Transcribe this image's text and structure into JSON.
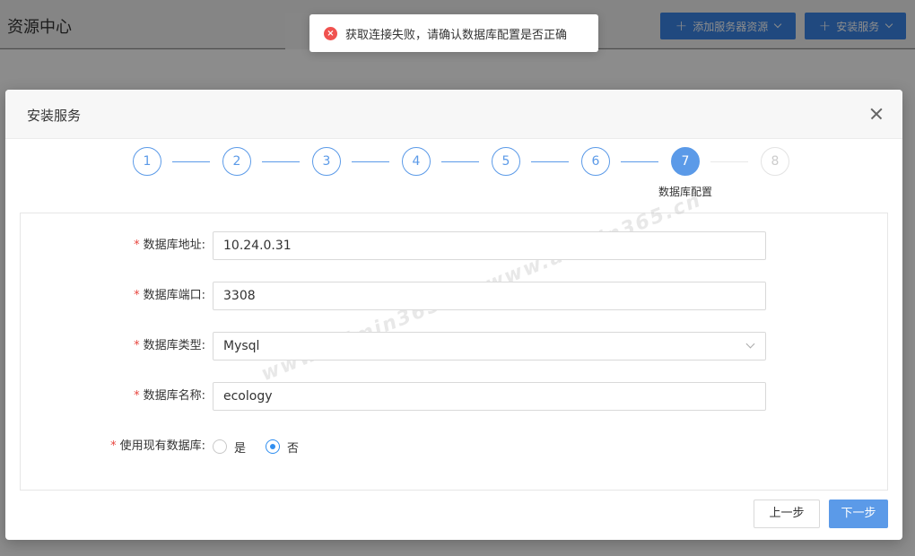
{
  "page": {
    "title": "资源中心",
    "add_server_button": "添加服务器资源",
    "install_service_button": "安装服务"
  },
  "toast": {
    "message": "获取连接失败，请确认数据库配置是否正确",
    "icon": "error-icon"
  },
  "modal": {
    "title": "安装服务",
    "steps": [
      "1",
      "2",
      "3",
      "4",
      "5",
      "6",
      "7",
      "8"
    ],
    "current_step": 7,
    "current_step_label": "数据库配置",
    "fields": {
      "db_address": {
        "label": "数据库地址:",
        "value": "10.24.0.31"
      },
      "db_port": {
        "label": "数据库端口:",
        "value": "3308"
      },
      "db_type": {
        "label": "数据库类型:",
        "value": "Mysql"
      },
      "db_name": {
        "label": "数据库名称:",
        "value": "ecology"
      },
      "use_existing": {
        "label": "使用现有数据库:",
        "options": [
          "是",
          "否"
        ],
        "selected": "否"
      }
    },
    "prev_button": "上一步",
    "next_button": "下一步"
  },
  "watermark": "www.admin365.cn",
  "colors": {
    "primary": "#5b9ae8",
    "header_button": "#3b86e8",
    "error": "#f0524f",
    "required": "#e8463f"
  }
}
